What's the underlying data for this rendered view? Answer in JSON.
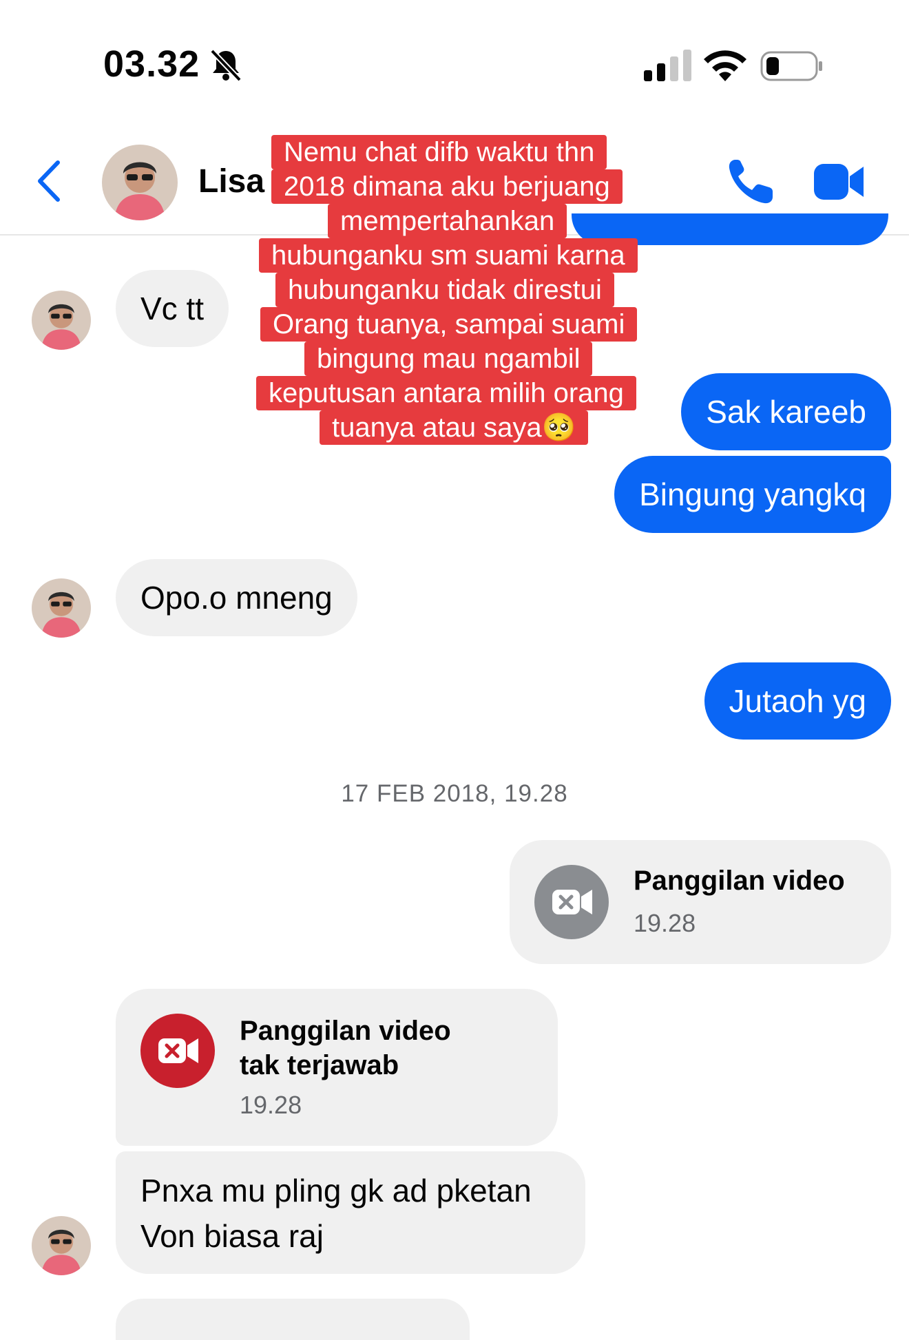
{
  "status_bar": {
    "time": "03.32",
    "icons": [
      "bell-slash-icon",
      "signal-icon",
      "wifi-icon",
      "battery-icon"
    ]
  },
  "header": {
    "contact_name": "Lisa",
    "icons": [
      "back-arrow-icon",
      "phone-icon",
      "video-camera-icon"
    ]
  },
  "colors": {
    "accent": "#0a66f5",
    "incoming_bubble": "#f0f0f0",
    "caption_bg": "#e63b3e",
    "missed_call": "#c8202d",
    "call_icon_gray": "#8a8d91"
  },
  "overlay_caption": {
    "lines": [
      "Nemu chat difb waktu thn",
      "2018 dimana aku berjuang",
      "mempertahankan",
      "hubunganku sm suami karna",
      "hubunganku tidak direstui",
      "Orang tuanya, sampai suami",
      "bingung mau ngambil",
      "keputusan antara milih orang",
      "tuanya atau saya🥺"
    ]
  },
  "messages": {
    "m1": "Vc tt",
    "m2": "Sak kareeb",
    "m3": "Bingung yangkq",
    "m4": "Opo.o mneng",
    "m5": "Jutaoh yg",
    "date_separator": "17 FEB 2018, 19.28",
    "outgoing_call": {
      "title": "Panggilan video",
      "time": "19.28"
    },
    "missed_call": {
      "title_line1": "Panggilan video",
      "title_line2": "tak terjawab",
      "time": "19.28"
    },
    "m6_line1": "Pnxa mu pling gk ad pketan",
    "m6_line2": "Von biasa raj"
  }
}
